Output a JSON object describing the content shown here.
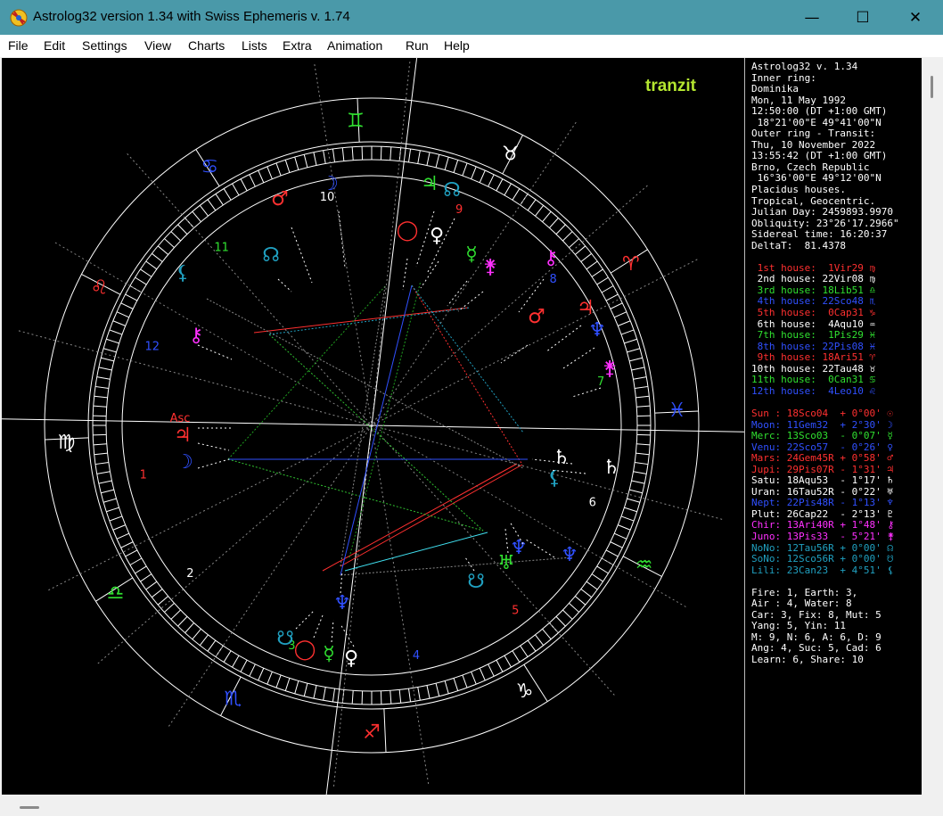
{
  "window": {
    "title": "Astrolog32 version 1.34 with Swiss Ephemeris v. 1.74",
    "controls": {
      "minimize": "—",
      "maximize": "☐",
      "close": "✕"
    }
  },
  "menu": [
    "File",
    "Edit",
    "Settings",
    "View",
    "Charts",
    "Lists",
    "Extra",
    "Animation",
    "Run",
    "Help"
  ],
  "chart": {
    "mode_label": "tranzit",
    "colors": {
      "fire": "#e02020",
      "earth": "#30c030",
      "air": "#2040ff",
      "water": "#20a0c0",
      "ring": "#ffffff"
    },
    "zodiac_glyphs": [
      "♊",
      "♉",
      "♈",
      "♓",
      "♒",
      "♑",
      "♐",
      "♏",
      "♎",
      "♍",
      "♌",
      "♋"
    ],
    "inner_cusp_numbers": [
      "10",
      "9",
      "8",
      "7",
      "6",
      "5",
      "4",
      "3",
      "2",
      "1",
      "12",
      "11"
    ],
    "outer_cusp_numbers": [
      "10",
      "9",
      "8",
      "7",
      "6",
      "5",
      "4",
      "3",
      "2",
      "1",
      "12",
      "11"
    ]
  },
  "info": {
    "header": [
      "Astrolog32 v. 1.34",
      "Inner ring:",
      "Dominika",
      "Mon, 11 May 1992",
      "12:50:00 (DT +1:00 GMT)",
      " 18°21'00\"E 49°41'00\"N",
      "Outer ring - Transit:",
      "Thu, 10 November 2022",
      "13:55:42 (DT +1:00 GMT)",
      "Brno, Czech Republic",
      " 16°36'00\"E 49°12'00\"N",
      "Placidus houses.",
      "Tropical, Geocentric.",
      "Julian Day: 2459893.9970",
      "Obliquity: 23°26'17.2966\"",
      "Sidereal time: 16:20:37",
      "DeltaT:  81.4378"
    ],
    "houses": [
      {
        "text": " 1st house:  1Vir29 ♍",
        "color": "#ff3030"
      },
      {
        "text": " 2nd house: 22Vir08 ♍",
        "color": "#ffffff"
      },
      {
        "text": " 3rd house: 18Lib51 ♎",
        "color": "#30e030"
      },
      {
        "text": " 4th house: 22Sco48 ♏",
        "color": "#3050ff"
      },
      {
        "text": " 5th house:  0Cap31 ♑",
        "color": "#ff3030"
      },
      {
        "text": " 6th house:  4Aqu10 ♒",
        "color": "#ffffff"
      },
      {
        "text": " 7th house:  1Pis29 ♓",
        "color": "#30e030"
      },
      {
        "text": " 8th house: 22Pis08 ♓",
        "color": "#3050ff"
      },
      {
        "text": " 9th house: 18Ari51 ♈",
        "color": "#ff3030"
      },
      {
        "text": "10th house: 22Tau48 ♉",
        "color": "#ffffff"
      },
      {
        "text": "11th house:  0Can31 ♋",
        "color": "#30e030"
      },
      {
        "text": "12th house:  4Leo10 ♌",
        "color": "#3050ff"
      }
    ],
    "planets": [
      {
        "text": "Sun : 18Sco04  + 0°00' ☉",
        "color": "#ff3030"
      },
      {
        "text": "Moon: 11Gem32  + 2°30' ☽",
        "color": "#3050ff"
      },
      {
        "text": "Merc: 13Sco03  - 0°07' ☿",
        "color": "#30e030"
      },
      {
        "text": "Venu: 22Sco57  - 0°26' ♀",
        "color": "#3050ff"
      },
      {
        "text": "Mars: 24Gem45R + 0°58' ♂",
        "color": "#ff3030"
      },
      {
        "text": "Jupi: 29Pis07R - 1°31' ♃",
        "color": "#ff3030"
      },
      {
        "text": "Satu: 18Aqu53  - 1°17' ♄",
        "color": "#ffffff"
      },
      {
        "text": "Uran: 16Tau52R - 0°22' ♅",
        "color": "#ffffff"
      },
      {
        "text": "Nept: 22Pis48R - 1°13' ♆",
        "color": "#3050ff"
      },
      {
        "text": "Plut: 26Cap22  - 2°13' ♇",
        "color": "#ffffff"
      },
      {
        "text": "Chir: 13Ari40R + 1°48' ⚷",
        "color": "#ff30ff"
      },
      {
        "text": "Juno: 13Pis33  - 5°21' ⚵",
        "color": "#ff30ff"
      },
      {
        "text": "NoNo: 12Tau56R + 0°00' ☊",
        "color": "#20a0c0"
      },
      {
        "text": "SoNo: 12Sco56R + 0°00' ☋",
        "color": "#20a0c0"
      },
      {
        "text": "Lili: 23Can23  + 4°51' ⚸",
        "color": "#20a0c0"
      }
    ],
    "summary": [
      "Fire: 1, Earth: 3,",
      "Air : 4, Water: 8",
      "Car: 3, Fix: 8, Mut: 5",
      "Yang: 5, Yin: 11",
      "M: 9, N: 6, A: 6, D: 9",
      "Ang: 4, Suc: 5, Cad: 6",
      "Learn: 6, Share: 10"
    ]
  }
}
